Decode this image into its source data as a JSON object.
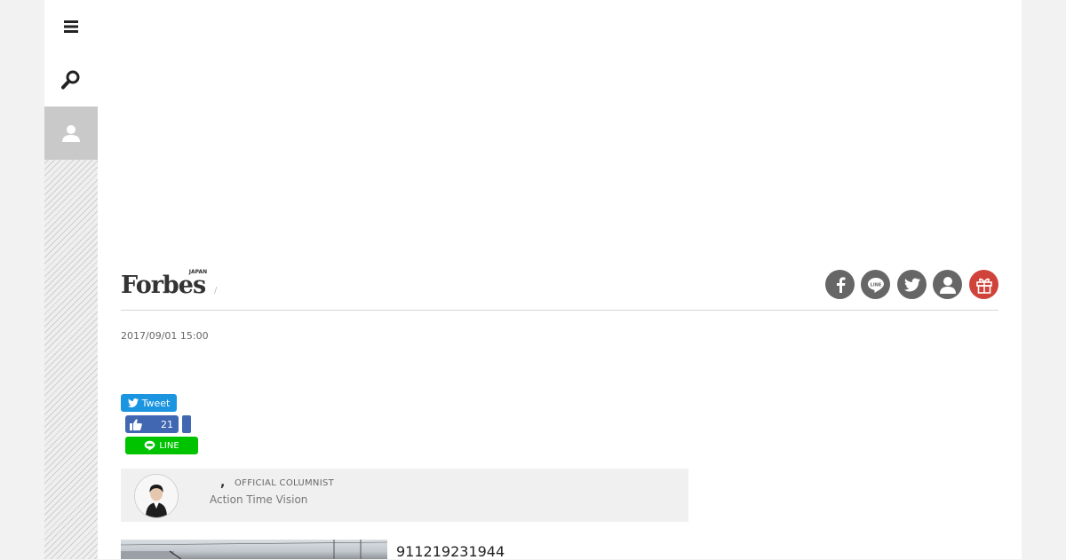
{
  "sidebar": {
    "menu_icon": "hamburger-icon",
    "search_icon": "search-icon",
    "user_icon": "user-icon"
  },
  "header": {
    "brand": "Forbes",
    "brand_sub": "JAPAN",
    "breadcrumb_separator": "/",
    "social_icons": [
      "facebook-icon",
      "line-icon",
      "twitter-icon",
      "member-icon",
      "gift-icon"
    ],
    "gift_color": "#d0433a",
    "social_color": "#666666"
  },
  "article": {
    "date": "2017/09/01 15:00",
    "id_text": "911219231944"
  },
  "share": {
    "tweet_label": "Tweet",
    "tweet_color": "#1b95e0",
    "like_count": "21",
    "like_color": "#4267b2",
    "line_label": "LINE",
    "line_color": "#00c300"
  },
  "author": {
    "name_separator": ",",
    "role": "OFFICIAL COLUMNIST",
    "organization": "Action Time Vision"
  }
}
